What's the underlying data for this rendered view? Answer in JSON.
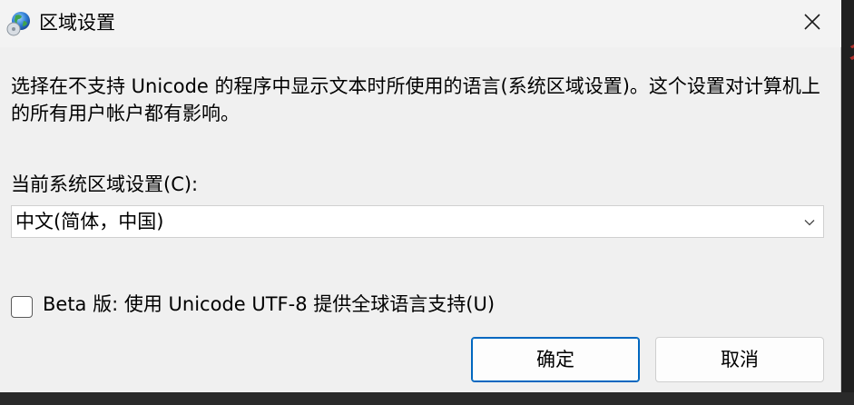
{
  "window": {
    "title": "区域设置",
    "icon": "globe-icon",
    "close_icon": "close-icon"
  },
  "description": "选择在不支持 Unicode 的程序中显示文本时所使用的语言(系统区域设置)。这个设置对计算机上的所有用户帐户都有影响。",
  "locale": {
    "label": "当前系统区域设置(C):",
    "selected": "中文(简体，中国)"
  },
  "beta_option": {
    "label": "Beta 版: 使用 Unicode UTF-8 提供全球语言支持(U)",
    "checked": false
  },
  "buttons": {
    "ok": "确定",
    "cancel": "取消"
  },
  "colors": {
    "accent": "#0067c0",
    "dialog_background": "#f0f0f0"
  }
}
